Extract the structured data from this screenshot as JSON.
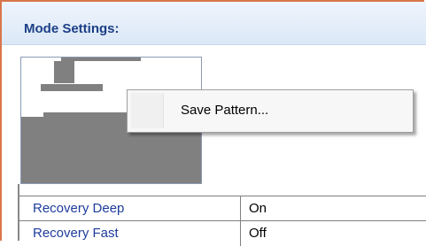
{
  "panel": {
    "title": "Mode Settings:"
  },
  "context_menu": {
    "items": [
      {
        "label": "Save Pattern..."
      }
    ]
  },
  "settings_table": {
    "rows": [
      {
        "name": "Recovery Deep",
        "value": "On"
      },
      {
        "name": "Recovery Fast",
        "value": "Off"
      }
    ]
  },
  "colors": {
    "frame_accent": "#d9764a",
    "header_text": "#1c3f86",
    "row_label_text": "#1e3c9c",
    "pattern_fill": "#808080"
  }
}
